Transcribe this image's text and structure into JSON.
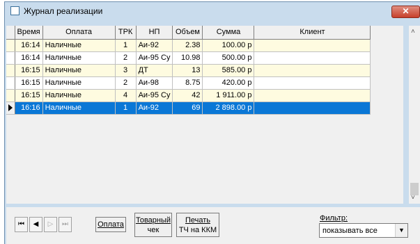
{
  "window": {
    "title": "Журнал реализации",
    "close_label": "✕"
  },
  "grid": {
    "headers": [
      "Время",
      "Оплата",
      "ТРК",
      "НП",
      "Объем",
      "Сумма",
      "Клиент"
    ],
    "rows": [
      {
        "time": "16:14",
        "payment": "Наличные",
        "trk": "1",
        "np": "Аи-92",
        "volume": "2.38",
        "sum": "100.00 р",
        "client": ""
      },
      {
        "time": "16:14",
        "payment": "Наличные",
        "trk": "2",
        "np": "Аи-95 Су",
        "volume": "10.98",
        "sum": "500.00 р",
        "client": ""
      },
      {
        "time": "16:15",
        "payment": "Наличные",
        "trk": "3",
        "np": "ДТ",
        "volume": "13",
        "sum": "585.00 р",
        "client": ""
      },
      {
        "time": "16:15",
        "payment": "Наличные",
        "trk": "2",
        "np": "Аи-98",
        "volume": "8.75",
        "sum": "420.00 р",
        "client": ""
      },
      {
        "time": "16:15",
        "payment": "Наличные",
        "trk": "4",
        "np": "Аи-95 Су",
        "volume": "42",
        "sum": "1 911.00 р",
        "client": ""
      },
      {
        "time": "16:16",
        "payment": "Наличные",
        "trk": "1",
        "np": "Аи-92",
        "volume": "69",
        "sum": "2 898.00 р",
        "client": ""
      }
    ],
    "selected_row": 5
  },
  "toolbar": {
    "first": "⏮",
    "prev": "◀",
    "next": "▷",
    "last": "⏭",
    "payment_btn": "Оплата",
    "receipt_btn_line1": "Товарный",
    "receipt_btn_line2": "чек",
    "print_btn_line1": "Печать",
    "print_btn_line2": "ТЧ на ККМ"
  },
  "filter": {
    "label": "Фильтр:",
    "value": "показывать все"
  },
  "colors": {
    "selection": "#0a77d6",
    "row_highlight": "#fefbe0"
  }
}
